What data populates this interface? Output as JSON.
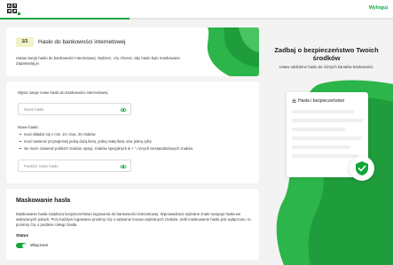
{
  "header": {
    "logo": {
      "cells": [
        "V",
        "E",
        "L",
        "O"
      ]
    },
    "logout_label": "Wyloguj",
    "progress_fraction": 0.33,
    "accent_color": "#11a63a"
  },
  "intro_card": {
    "badge": "1/1",
    "title": "Hasło do bankowości internetowej",
    "description": "Ustaw swoje hasło do bankowości internetowej. Wybierz, czy chcesz, aby hasło było maskowane. Zapamiętaj je."
  },
  "password_card": {
    "new_password_label": "Wpisz swoje nowe hasło do bankowości internetowej:",
    "new_password_placeholder": "Nowe hasło",
    "requirements_title": "Nowe hasło:",
    "requirements": [
      "musi składać się z min. 10 i max. 20 znaków",
      "musi zawierać przynajmniej jedną dużą literę, jedną małą literę oraz jedną cyfrę",
      "nie może zawierać polskich znaków, spacji, znaków specjalnych & + \" i innych niestandardowych znaków"
    ],
    "repeat_password_placeholder": "Powtórz nowe hasło",
    "eye_icon": "eye-icon"
  },
  "masking_card": {
    "title": "Maskowanie hasła",
    "description": "Maskowanie hasła zwiększa bezpieczeństwo logowania do bankowości internetowej. Wprowadzasz wybrane znaki swojego hasła we wskazanych polach. Przy każdym logowaniu prosimy Cię o wpisanie losowo wybranych znaków. Jeśli maskowanie hasła jest wyłączone, to prosimy Cię o podanie całego hasła.",
    "status_label": "Status",
    "toggle_label": "Włączone",
    "toggle_on": true
  },
  "aside": {
    "title": "Zadbaj o bezpieczeństwo Twoich środków",
    "subtitle": "Ustaw oddzielne hasło do różnych kanałów bankowości.",
    "mock_title": "Hasła i bezpieczeństwo",
    "shield_icon": "shield-check-icon"
  }
}
